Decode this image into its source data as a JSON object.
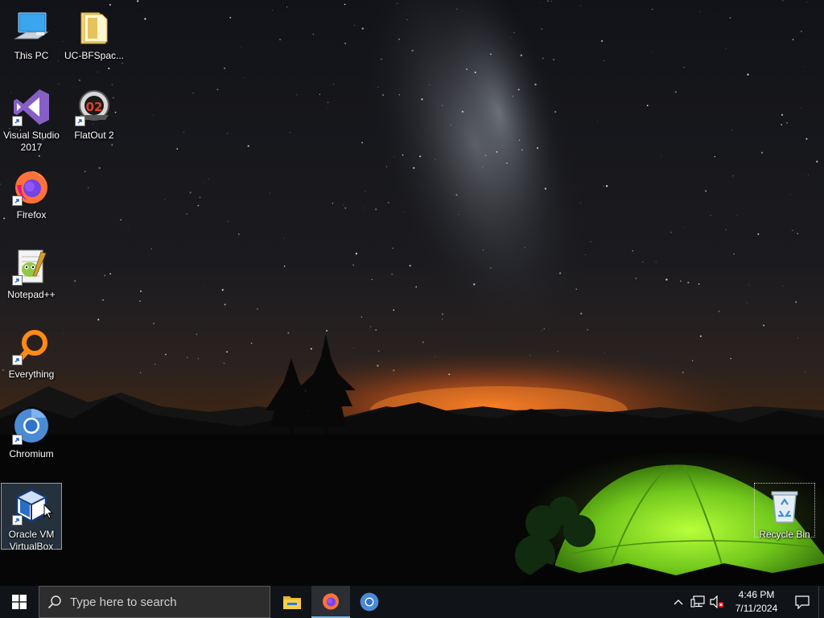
{
  "desktop": {
    "icons": [
      {
        "label": "This PC",
        "icon": "this-pc-icon",
        "shortcut": false
      },
      {
        "label": "UC-BFSpac...",
        "icon": "folder-icon",
        "shortcut": false
      },
      {
        "label": "Visual Studio 2017",
        "icon": "visual-studio-icon",
        "shortcut": true
      },
      {
        "label": "FlatOut 2",
        "icon": "flatout-icon",
        "shortcut": true
      },
      {
        "label": "Firefox",
        "icon": "firefox-icon",
        "shortcut": true
      },
      {
        "label": "Notepad++",
        "icon": "notepad-plus-plus-icon",
        "shortcut": true
      },
      {
        "label": "Everything",
        "icon": "everything-search-icon",
        "shortcut": true
      },
      {
        "label": "Chromium",
        "icon": "chromium-icon",
        "shortcut": true
      },
      {
        "label": "Oracle VM VirtualBox",
        "icon": "virtualbox-icon",
        "shortcut": true,
        "selected": true
      },
      {
        "label": "Recycle Bin",
        "icon": "recycle-bin-icon",
        "shortcut": false,
        "focused": true
      }
    ]
  },
  "taskbar": {
    "start": {
      "icon": "windows-logo-icon"
    },
    "search": {
      "placeholder": "Type here to search",
      "icon": "search-icon"
    },
    "pinned": [
      {
        "name": "File Explorer",
        "icon": "file-explorer-icon",
        "state": "pinned"
      },
      {
        "name": "Firefox",
        "icon": "firefox-icon",
        "state": "active"
      },
      {
        "name": "Chromium",
        "icon": "chromium-icon",
        "state": "pinned"
      }
    ],
    "tray": {
      "icons": [
        "chevron-up-icon",
        "network-icon",
        "volume-muted-icon"
      ],
      "time": "4:46 PM",
      "date": "7/11/2024",
      "notifications_icon": "action-center-icon"
    }
  },
  "colors": {
    "taskbar_bg": "#101418",
    "search_bg": "#2d2d2d",
    "active_indicator": "#76b9ed",
    "tent_green": "#7ed321",
    "sunset_orange": "#e0601a"
  }
}
